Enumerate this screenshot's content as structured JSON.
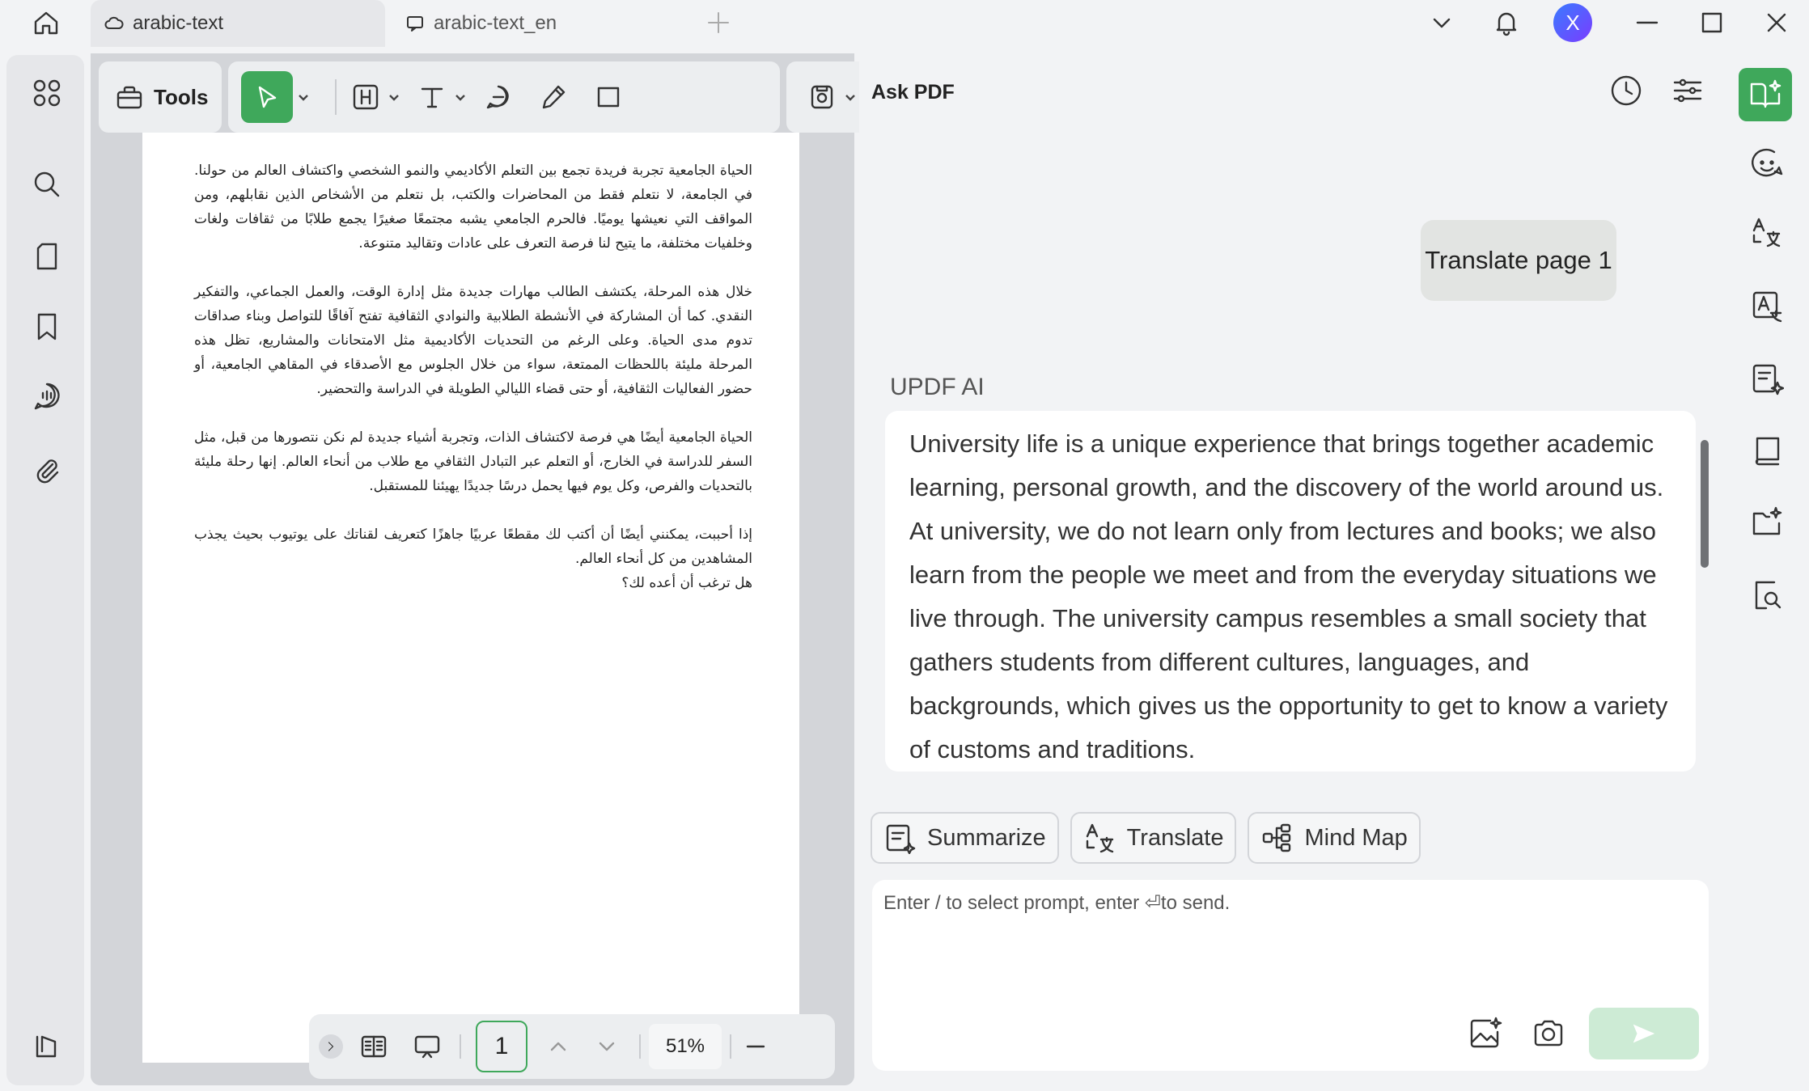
{
  "tabs": [
    {
      "label": "arabic-text",
      "icon": "cloud-icon"
    },
    {
      "label": "arabic-text_en",
      "icon": "chat-icon"
    }
  ],
  "user": {
    "initial": "X"
  },
  "toolbar": {
    "tools_label": "Tools"
  },
  "document": {
    "paragraphs": [
      "الحياة الجامعية تجربة فريدة تجمع بين التعلم الأكاديمي والنمو الشخصي واكتشاف العالم من حولنا. في الجامعة، لا نتعلم فقط من المحاضرات والكتب، بل نتعلم من الأشخاص الذين نقابلهم، ومن المواقف التي نعيشها يوميًا. فالحرم الجامعي يشبه مجتمعًا صغيرًا يجمع طلابًا من ثقافات ولغات وخلفيات مختلفة، ما يتيح لنا فرصة التعرف على عادات وتقاليد متنوعة.",
      "خلال هذه المرحلة، يكتشف الطالب مهارات جديدة مثل إدارة الوقت، والعمل الجماعي، والتفكير النقدي. كما أن المشاركة في الأنشطة الطلابية والنوادي الثقافية تفتح آفاقًا للتواصل وبناء صداقات تدوم مدى الحياة. وعلى الرغم من التحديات الأكاديمية مثل الامتحانات والمشاريع، تظل هذه المرحلة مليئة باللحظات الممتعة، سواء من خلال الجلوس مع الأصدقاء في المقاهي الجامعية، أو حضور الفعاليات الثقافية، أو حتى قضاء الليالي الطويلة في الدراسة والتحضير.",
      "الحياة الجامعية أيضًا هي فرصة لاكتشاف الذات، وتجربة أشياء جديدة لم نكن نتصورها من قبل، مثل السفر للدراسة في الخارج، أو التعلم عبر التبادل الثقافي مع طلاب من أنحاء العالم. إنها رحلة مليئة بالتحديات والفرص، وكل يوم فيها يحمل درسًا جديدًا يهيئنا للمستقبل.",
      "إذا أحببت، يمكنني أيضًا أن أكتب لك مقطعًا عربيًا جاهزًا كتعريف لقناتك على يوتيوب بحيث يجذب المشاهدين من كل أنحاء العالم.\nهل ترغب أن أعده لك؟"
    ]
  },
  "pager": {
    "page": "1",
    "zoom": "51%"
  },
  "ask_pdf": {
    "title": "Ask PDF",
    "user_message": "Translate page 1",
    "ai_name": "UPDF AI",
    "ai_response": "University life is a unique experience that brings together academic learning, personal growth, and the discovery of the world around us. At university, we do not learn only from lectures and books; we also learn from the people we meet and from the everyday situations we live through. The university campus resembles a small society that gathers students from different cultures, languages, and backgrounds, which gives us the opportunity to get to know a variety of customs and traditions.",
    "actions": {
      "summarize": "Summarize",
      "translate": "Translate",
      "mind_map": "Mind Map"
    },
    "input_placeholder": "Enter / to select prompt, enter ⏎to send."
  },
  "colors": {
    "accent": "#3fa85b",
    "accent_light": "#cdebd5",
    "background": "#f2f3f5"
  }
}
